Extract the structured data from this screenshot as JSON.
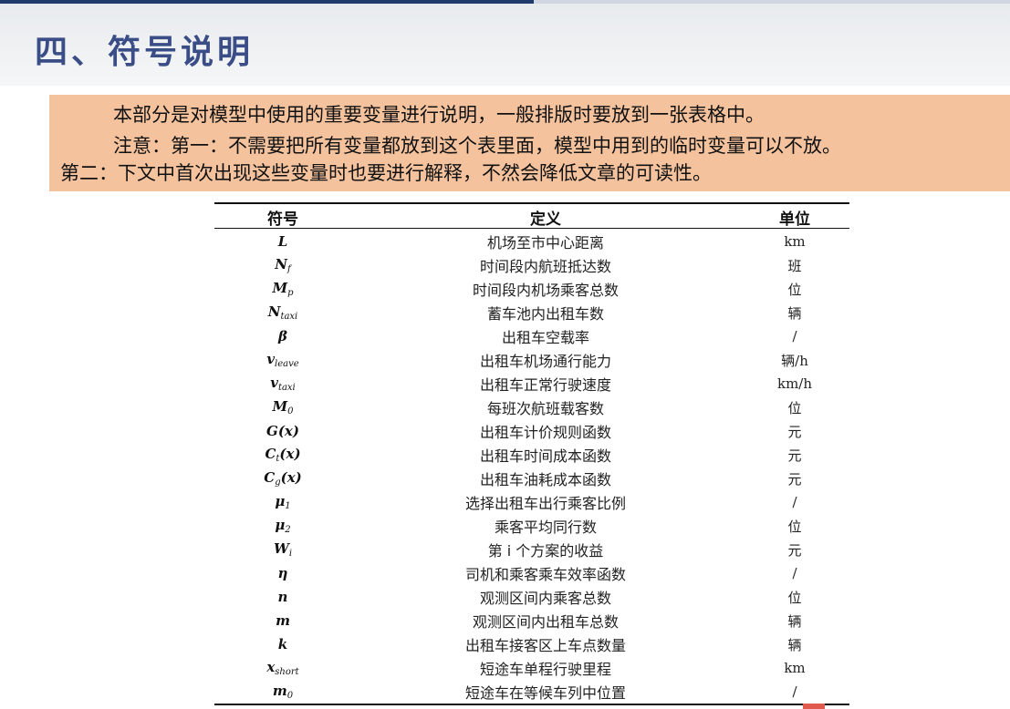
{
  "slide": {
    "title": "四、符号说明"
  },
  "note": {
    "line1": "本部分是对模型中使用的重要变量进行说明，一般排版时要放到一张表格中。",
    "line2": "注意：第一：不需要把所有变量都放到这个表里面，模型中用到的临时变量可以不放。",
    "line3": "第二：下文中首次出现这些变量时也要进行解释，不然会降低文章的可读性。"
  },
  "table": {
    "headers": [
      "符号",
      "定义",
      "单位"
    ],
    "rows": [
      {
        "sym": "L",
        "sub": "",
        "def": "机场至市中心距离",
        "unit": "km"
      },
      {
        "sym": "N",
        "sub": "f",
        "def": "时间段内航班抵达数",
        "unit": "班"
      },
      {
        "sym": "M",
        "sub": "p",
        "def": "时间段内机场乘客总数",
        "unit": "位"
      },
      {
        "sym": "N",
        "sub": "taxi",
        "def": "蓄车池内出租车数",
        "unit": "辆"
      },
      {
        "sym": "β",
        "sub": "",
        "def": "出租车空载率",
        "unit": "/"
      },
      {
        "sym": "v",
        "sub": "leave",
        "def": "出租车机场通行能力",
        "unit": "辆/h"
      },
      {
        "sym": "v",
        "sub": "taxi",
        "def": "出租车正常行驶速度",
        "unit": "km/h"
      },
      {
        "sym": "M",
        "sub": "0",
        "def": "每班次航班载客数",
        "unit": "位"
      },
      {
        "sym": "G(x)",
        "sub": "",
        "def": "出租车计价规则函数",
        "unit": "元"
      },
      {
        "sym": "C",
        "sub": "t",
        "tail": "(x)",
        "def": "出租车时间成本函数",
        "unit": "元"
      },
      {
        "sym": "C",
        "sub": "g",
        "tail": "(x)",
        "def": "出租车油耗成本函数",
        "unit": "元"
      },
      {
        "sym": "μ",
        "sub": "1",
        "def": "选择出租车出行乘客比例",
        "unit": "/"
      },
      {
        "sym": "μ",
        "sub": "2",
        "def": "乘客平均同行数",
        "unit": "位"
      },
      {
        "sym": "W",
        "sub": "i",
        "def": "第 i 个方案的收益",
        "unit": "元"
      },
      {
        "sym": "η",
        "sub": "",
        "def": "司机和乘客乘车效率函数",
        "unit": "/"
      },
      {
        "sym": "n",
        "sub": "",
        "def": "观测区间内乘客总数",
        "unit": "位"
      },
      {
        "sym": "m",
        "sub": "",
        "def": "观测区间内出租车总数",
        "unit": "辆"
      },
      {
        "sym": "k",
        "sub": "",
        "def": "出租车接客区上车点数量",
        "unit": "辆"
      },
      {
        "sym": "x",
        "sub": "short",
        "def": "短途车单程行驶里程",
        "unit": "km"
      },
      {
        "sym": "m",
        "sub": "0",
        "def": "短途车在等候车列中位置",
        "unit": "/"
      }
    ]
  }
}
